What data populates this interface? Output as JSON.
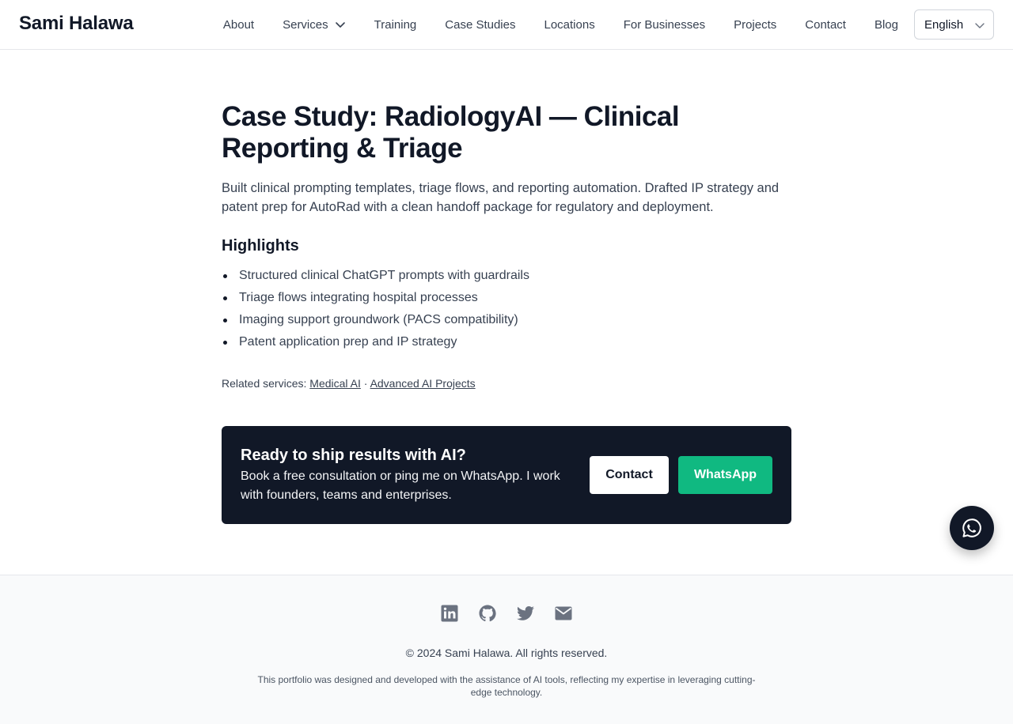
{
  "header": {
    "brand": "Sami Halawa",
    "nav": [
      {
        "label": "About"
      },
      {
        "label": "Services",
        "has_dropdown": true
      },
      {
        "label": "Training"
      },
      {
        "label": "Case Studies"
      },
      {
        "label": "Locations"
      },
      {
        "label": "For Businesses"
      },
      {
        "label": "Projects"
      },
      {
        "label": "Contact"
      },
      {
        "label": "Blog"
      }
    ],
    "language": {
      "selected": "English"
    }
  },
  "main": {
    "title": "Case Study: RadiologyAI — Clinical Reporting & Triage",
    "lead": "Built clinical prompting templates, triage flows, and reporting automation. Drafted IP strategy and patent prep for AutoRad with a clean handoff package for regulatory and deployment.",
    "highlights_heading": "Highlights",
    "highlights": [
      "Structured clinical ChatGPT prompts with guardrails",
      "Triage flows integrating hospital processes",
      "Imaging support groundwork (PACS compatibility)",
      "Patent application prep and IP strategy"
    ],
    "related": {
      "label": "Related services:",
      "separator": "·",
      "links": [
        "Medical AI",
        "Advanced AI Projects"
      ]
    }
  },
  "cta": {
    "title": "Ready to ship results with AI?",
    "text": "Book a free consultation or ping me on WhatsApp. I work with founders, teams and enterprises.",
    "contact_label": "Contact",
    "whatsapp_label": "WhatsApp"
  },
  "footer": {
    "social": [
      "linkedin-icon",
      "github-icon",
      "twitter-icon",
      "mail-icon"
    ],
    "copyright": "© 2024 Sami Halawa. All rights reserved.",
    "disclaimer": "This portfolio was designed and developed with the assistance of AI tools, reflecting my expertise in leveraging cutting-edge technology."
  },
  "colors": {
    "dark": "#111827",
    "whatsapp_green": "#10b981",
    "footer_bg": "#f9fafb",
    "icon_gray": "#6b7280"
  }
}
